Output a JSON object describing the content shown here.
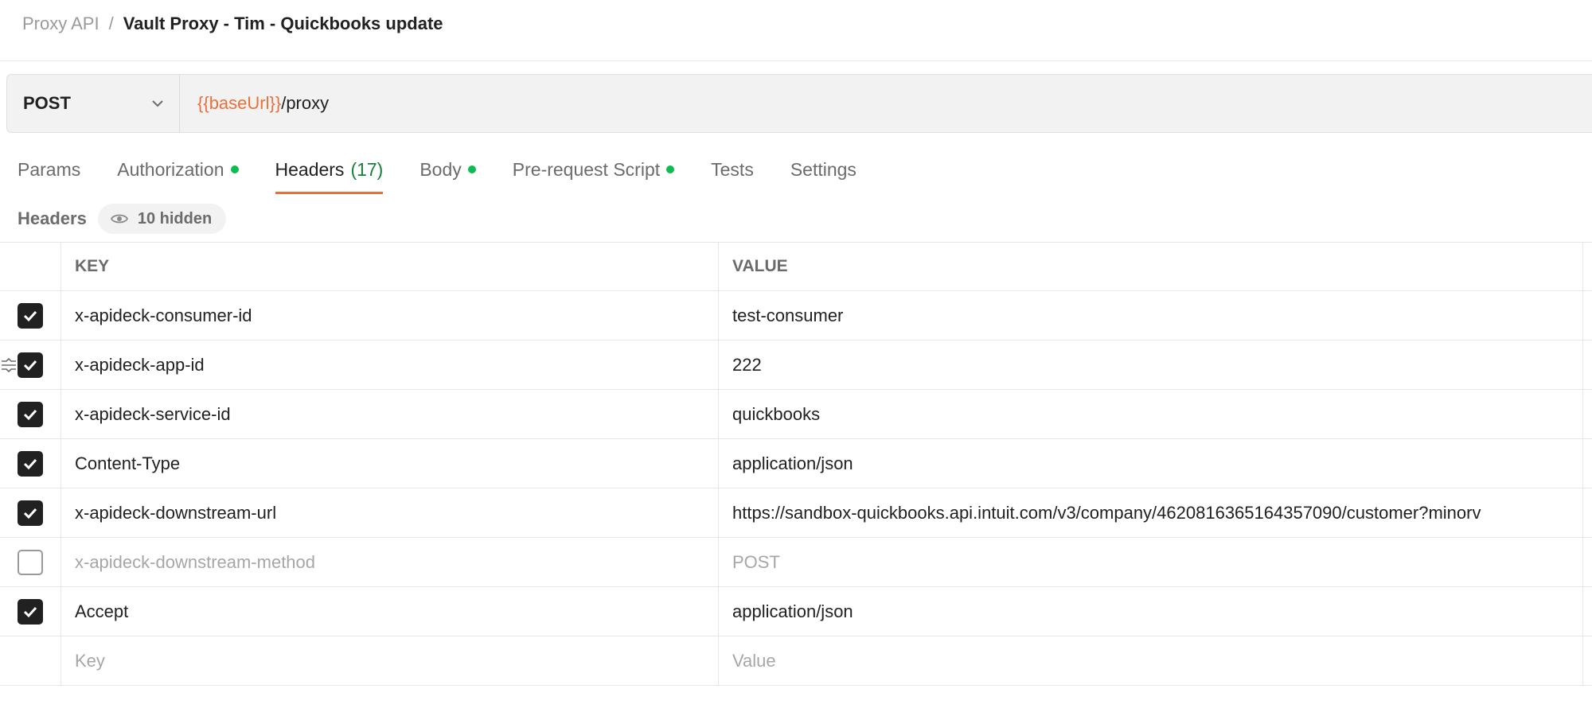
{
  "breadcrumb": {
    "parent": "Proxy API",
    "separator": "/",
    "current": "Vault Proxy - Tim - Quickbooks update"
  },
  "request": {
    "method": "POST",
    "url_variable": "{{baseUrl}}",
    "url_path": "/proxy"
  },
  "tabs": [
    {
      "label": "Params",
      "dot": false,
      "count": ""
    },
    {
      "label": "Authorization",
      "dot": true,
      "count": ""
    },
    {
      "label": "Headers",
      "dot": false,
      "count": "(17)",
      "active": true
    },
    {
      "label": "Body",
      "dot": true,
      "count": ""
    },
    {
      "label": "Pre-request Script",
      "dot": true,
      "count": ""
    },
    {
      "label": "Tests",
      "dot": false,
      "count": ""
    },
    {
      "label": "Settings",
      "dot": false,
      "count": ""
    }
  ],
  "headers_section": {
    "title": "Headers",
    "hidden_label": "10 hidden",
    "hidden_icon": "eye-icon"
  },
  "table": {
    "columns": {
      "key": "KEY",
      "value": "VALUE"
    },
    "rows": [
      {
        "checked": true,
        "key": "x-apideck-consumer-id",
        "value": "test-consumer"
      },
      {
        "checked": true,
        "key": "x-apideck-app-id",
        "value": "222"
      },
      {
        "checked": true,
        "key": "x-apideck-service-id",
        "value": "quickbooks"
      },
      {
        "checked": true,
        "key": "Content-Type",
        "value": "application/json"
      },
      {
        "checked": true,
        "key": "x-apideck-downstream-url",
        "value": "https://sandbox-quickbooks.api.intuit.com/v3/company/4620816365164357090/customer?minorv"
      },
      {
        "checked": false,
        "key": "x-apideck-downstream-method",
        "value": "POST"
      },
      {
        "checked": true,
        "key": "Accept",
        "value": "application/json"
      }
    ],
    "new_row": {
      "key_placeholder": "Key",
      "value_placeholder": "Value"
    }
  },
  "colors": {
    "accent": "#e8703a",
    "dot": "#0cbb52",
    "count": "#158239",
    "checkbox": "#212121"
  }
}
